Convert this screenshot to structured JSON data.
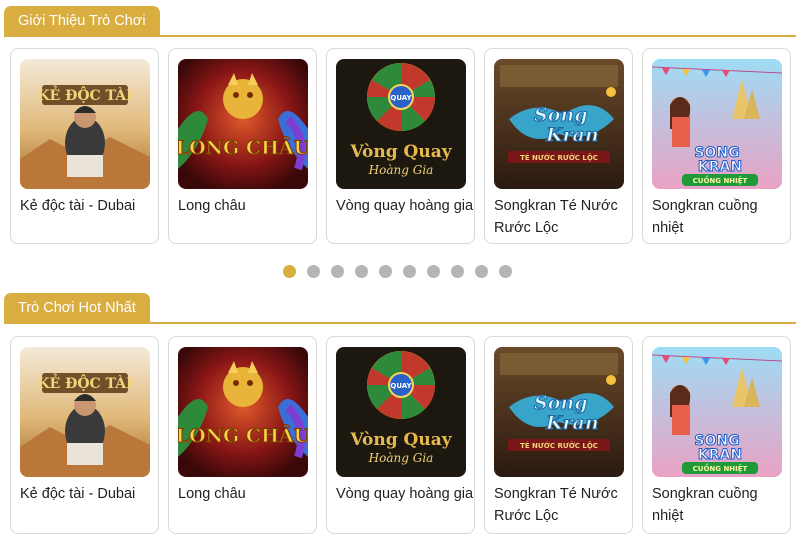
{
  "accent_color": "#d9ad3f",
  "sections": [
    {
      "heading": "Giới Thiệu Trò Chơi",
      "games": [
        {
          "title": "Kẻ độc tài - Dubai",
          "thumb_text": "KẺ ĐỘC TÀI"
        },
        {
          "title": "Long châu",
          "thumb_text": "LONG CHÂU"
        },
        {
          "title": "Vòng quay hoàng gia",
          "thumb_text": "Vòng Quay",
          "thumb_text2": "Hoàng Gia",
          "wheel_center": "QUAY"
        },
        {
          "title": "Songkran Té Nước Rước Lộc",
          "thumb_text": "Song",
          "thumb_text2": "Kran",
          "thumb_text3": "TÉ NƯỚC RƯỚC LỘC"
        },
        {
          "title": "Songkran cuồng nhiệt",
          "thumb_text": "SONG",
          "thumb_text2": "KRAN",
          "thumb_text3": "CUỒNG NHIỆT"
        }
      ]
    },
    {
      "heading": "Trò Chơi Hot Nhất",
      "games": [
        {
          "title": "Kẻ độc tài - Dubai",
          "thumb_text": "KẺ ĐỘC TÀI"
        },
        {
          "title": "Long châu",
          "thumb_text": "LONG CHÂU"
        },
        {
          "title": "Vòng quay hoàng gia",
          "thumb_text": "Vòng Quay",
          "thumb_text2": "Hoàng Gia",
          "wheel_center": "QUAY"
        },
        {
          "title": "Songkran Té Nước Rước Lộc",
          "thumb_text": "Song",
          "thumb_text2": "Kran",
          "thumb_text3": "TÉ NƯỚC RƯỚC LỘC"
        },
        {
          "title": "Songkran cuồng nhiệt",
          "thumb_text": "SONG",
          "thumb_text2": "KRAN",
          "thumb_text3": "CUỒNG NHIỆT"
        }
      ]
    }
  ],
  "carousel": {
    "page_count": 10,
    "active_index": 0
  }
}
